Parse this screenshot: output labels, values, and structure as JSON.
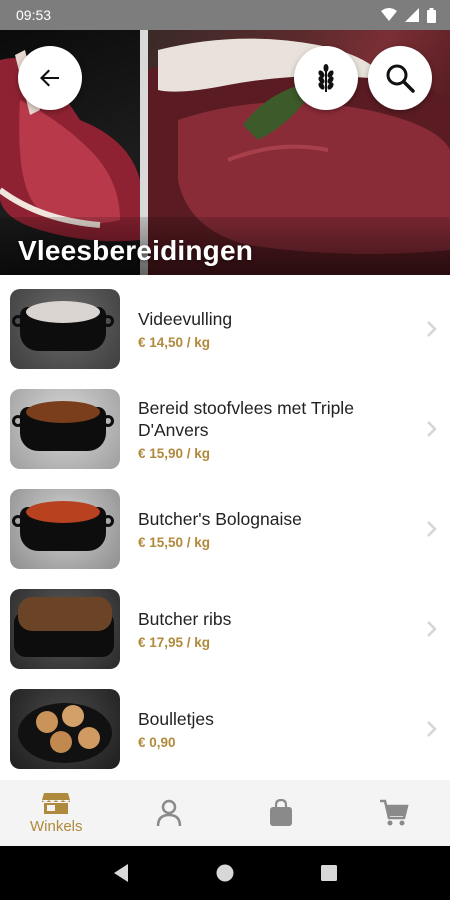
{
  "status_bar": {
    "time": "09:53"
  },
  "category": {
    "title": "Vleesbereidingen"
  },
  "products": [
    {
      "name": "Videevulling",
      "price": "€ 14,50 / kg",
      "food_color": "#d9d4cf"
    },
    {
      "name": "Bereid stoofvlees met Triple D'Anvers",
      "price": "€ 15,90 / kg",
      "food_color": "#7a3e1c"
    },
    {
      "name": "Butcher's Bolognaise",
      "price": "€ 15,50 / kg",
      "food_color": "#b8411f"
    },
    {
      "name": "Butcher ribs",
      "price": "€ 17,95 / kg",
      "food_color": "#6b4326"
    },
    {
      "name": "Boulletjes",
      "price": "€ 0,90",
      "food_color": "#c9935a"
    }
  ],
  "bottom_nav": {
    "items": [
      {
        "label": "Winkels",
        "icon": "store-icon",
        "active": true
      },
      {
        "label": "",
        "icon": "user-icon",
        "active": false
      },
      {
        "label": "",
        "icon": "shopping-bag-icon",
        "active": false
      },
      {
        "label": "",
        "icon": "cart-icon",
        "active": false
      }
    ]
  },
  "colors": {
    "accent": "#b08a3c",
    "inactive_icon": "#8a8a8a"
  }
}
